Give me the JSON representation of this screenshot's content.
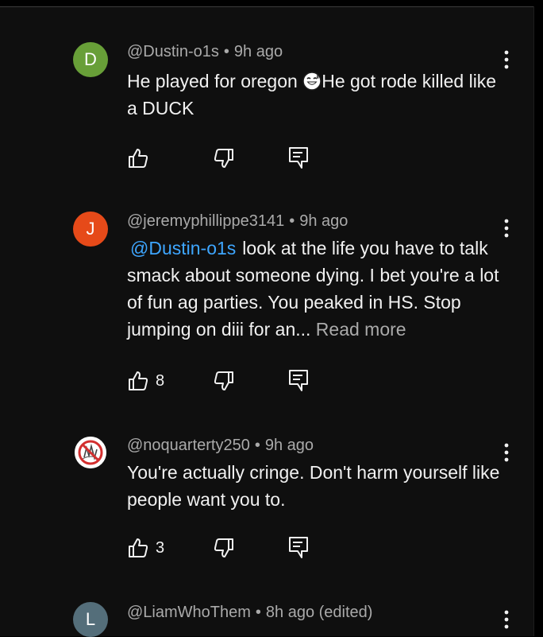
{
  "comments": [
    {
      "avatar_letter": "D",
      "avatar_color": "#689f38",
      "author": "@Dustin-o1s",
      "time": "9h ago",
      "text_before_emoji": "He played for oregon ",
      "emoji_icon": "grinning-sweat-face-emoji",
      "text_after_emoji": "He got rode killed like a DUCK",
      "like_count": ""
    },
    {
      "avatar_letter": "J",
      "avatar_color": "#e64a19",
      "author": "@jeremyphillippe3141",
      "time": "9h ago",
      "mention": "@Dustin-o1s",
      "text": "look at the life you have to talk smack about someone dying. I bet you're a lot of fun ag parties. You peaked in HS. Stop jumping on diii for an...",
      "read_more": "Read more",
      "like_count": "8"
    },
    {
      "avatar_icon": "no-symbol-avatar-image",
      "author": "@noquarterty250",
      "time": "9h ago",
      "text": "You're actually cringe. Don't harm yourself like people want you to.",
      "like_count": "3"
    },
    {
      "avatar_letter": "L",
      "avatar_color": "#546e7a",
      "author": "@LiamWhoThem",
      "time": "8h ago (edited)"
    }
  ],
  "separator": "•",
  "icons": {
    "like": "thumbs-up-icon",
    "dislike": "thumbs-down-icon",
    "reply": "reply-comment-icon",
    "menu": "more-vertical-icon"
  },
  "colors": {
    "background": "#0f0f0f",
    "text": "#f1f1f1",
    "secondary_text": "#aaaaaa",
    "link": "#3ea6ff"
  }
}
